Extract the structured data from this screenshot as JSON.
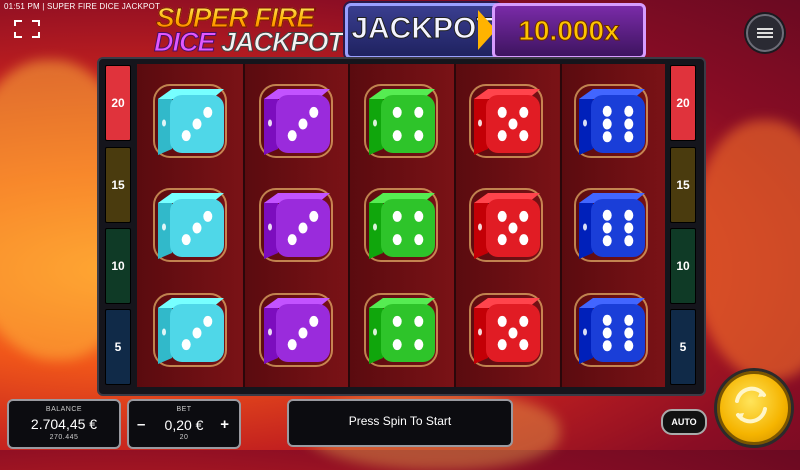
{
  "status_bar": {
    "time": "01:51 PM",
    "game_title": "SUPER FIRE DICE JACKPOT"
  },
  "logo": {
    "line1": "SUPER FIRE",
    "line2a": "DICE",
    "line2b": "JACKPOT"
  },
  "jackpot": {
    "label": "JACKPOT",
    "multiplier": "10.000x"
  },
  "levels": [
    {
      "value": "20",
      "color": "#e0333c"
    },
    {
      "value": "15",
      "color": "#4a3b0e"
    },
    {
      "value": "10",
      "color": "#0f3a26"
    },
    {
      "value": "5",
      "color": "#102a48"
    }
  ],
  "reels": [
    {
      "color": "cyan",
      "hex": "#4fd7e8",
      "faces": [
        3,
        3,
        3
      ]
    },
    {
      "color": "purple",
      "hex": "#9a2bdc",
      "faces": [
        3,
        3,
        3
      ]
    },
    {
      "color": "green",
      "hex": "#2ec42a",
      "faces": [
        4,
        4,
        4
      ]
    },
    {
      "color": "red",
      "hex": "#e11c24",
      "faces": [
        5,
        5,
        5
      ]
    },
    {
      "color": "blue",
      "hex": "#1a3ed8",
      "faces": [
        6,
        6,
        6
      ]
    }
  ],
  "balance": {
    "label": "BALANCE",
    "amount": "2.704,45 €",
    "credits": "270.445"
  },
  "bet": {
    "label": "BET",
    "minus": "–",
    "amount": "0,20 €",
    "plus": "+",
    "credits": "20"
  },
  "message": "Press Spin To Start",
  "auto_label": "AUTO",
  "icons": {
    "fullscreen": "fullscreen-icon",
    "menu": "hamburger-menu-icon",
    "spin": "spin-arrows-icon"
  }
}
